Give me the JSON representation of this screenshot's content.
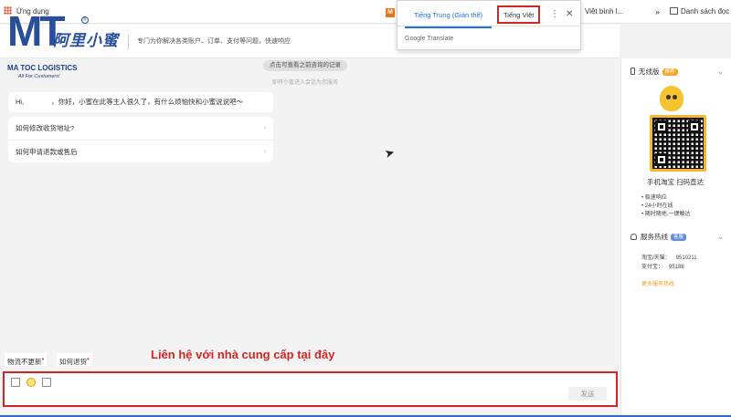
{
  "bookmarks": {
    "apps_label": "Ứng dụng",
    "m_icon": "M",
    "partial_item": "Việt bình l...",
    "more": "»",
    "reading_list": "Danh sách đọc"
  },
  "header": {
    "brand": "阿里小蜜",
    "tagline": "专门为你解决各类账户、订单、支付等问题，快速响应"
  },
  "watermark": {
    "mark": "MT",
    "registered": "®",
    "company": "MA TOC LOGISTICS",
    "slogan": "All For Customers!"
  },
  "chat": {
    "history_link": "点击可查看之前咨询的记录",
    "system_note": "即将小蜜进入会话为您服务",
    "greeting_start": "Hi,",
    "greeting_rest": "，你好，小蜜在此等主人很久了，有什么烦恼快和小蜜说说吧～",
    "faq": [
      {
        "label": "如何修改收货地址?"
      },
      {
        "label": "如何申请退款或售后"
      }
    ],
    "quick_chips": [
      "物流不更新",
      "如何退货"
    ],
    "send_label": "发送"
  },
  "annotation": "Liên hệ với nhà cung cấp tại đây",
  "right_panel": {
    "wireless_title": "无线版",
    "wireless_badge": "推荐",
    "qr_caption": "手机淘宝  扫码直达",
    "features": [
      "极速响应",
      "24小时在线",
      "随时随地,一键触达"
    ],
    "hotline_title": "服务热线",
    "hotline_badge": "客服",
    "hotlines": [
      {
        "label": "淘宝/天猫：",
        "number": "9510211"
      },
      {
        "label": "支付宝：",
        "number": "95188"
      }
    ],
    "more_hotlines": "更多服务热线"
  },
  "translate_popup": {
    "tab_source": "Tiếng Trung (Giản thể)",
    "tab_target": "Tiếng Việt",
    "brand": "Google Translate"
  },
  "colors": {
    "annotation_red": "#d42525",
    "logo_blue": "#2a4f9a",
    "translate_blue": "#1a73e8",
    "badge_orange": "#f7a823"
  }
}
